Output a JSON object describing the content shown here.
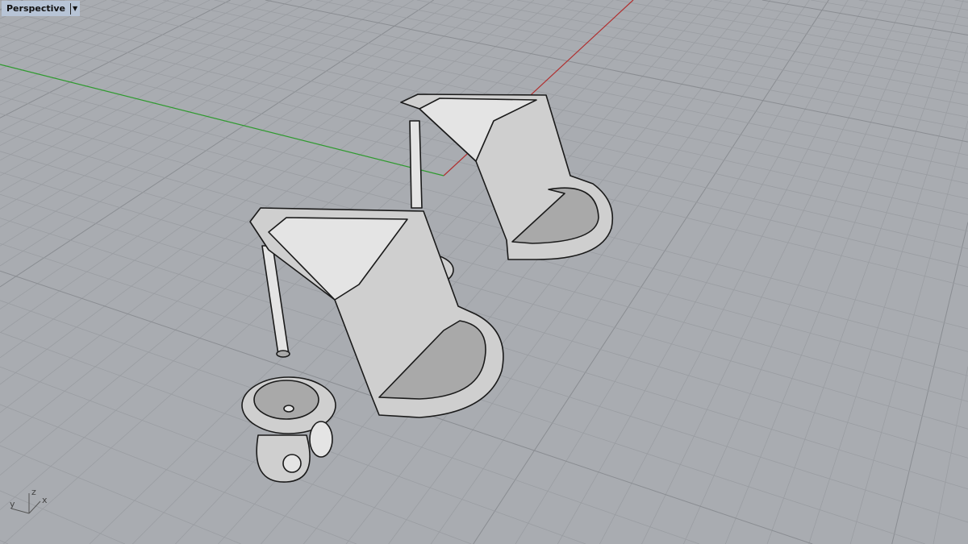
{
  "viewport": {
    "label": "Perspective",
    "menu_icon": "triangle-down-icon"
  },
  "axis_widget": {
    "x": "x",
    "y": "y",
    "z": "z"
  },
  "colors": {
    "background": "#a9acb1",
    "grid_minor": "#9a9da2",
    "grid_major": "#8a8d92",
    "x_axis": "#b03030",
    "y_axis": "#2e9a2e"
  }
}
